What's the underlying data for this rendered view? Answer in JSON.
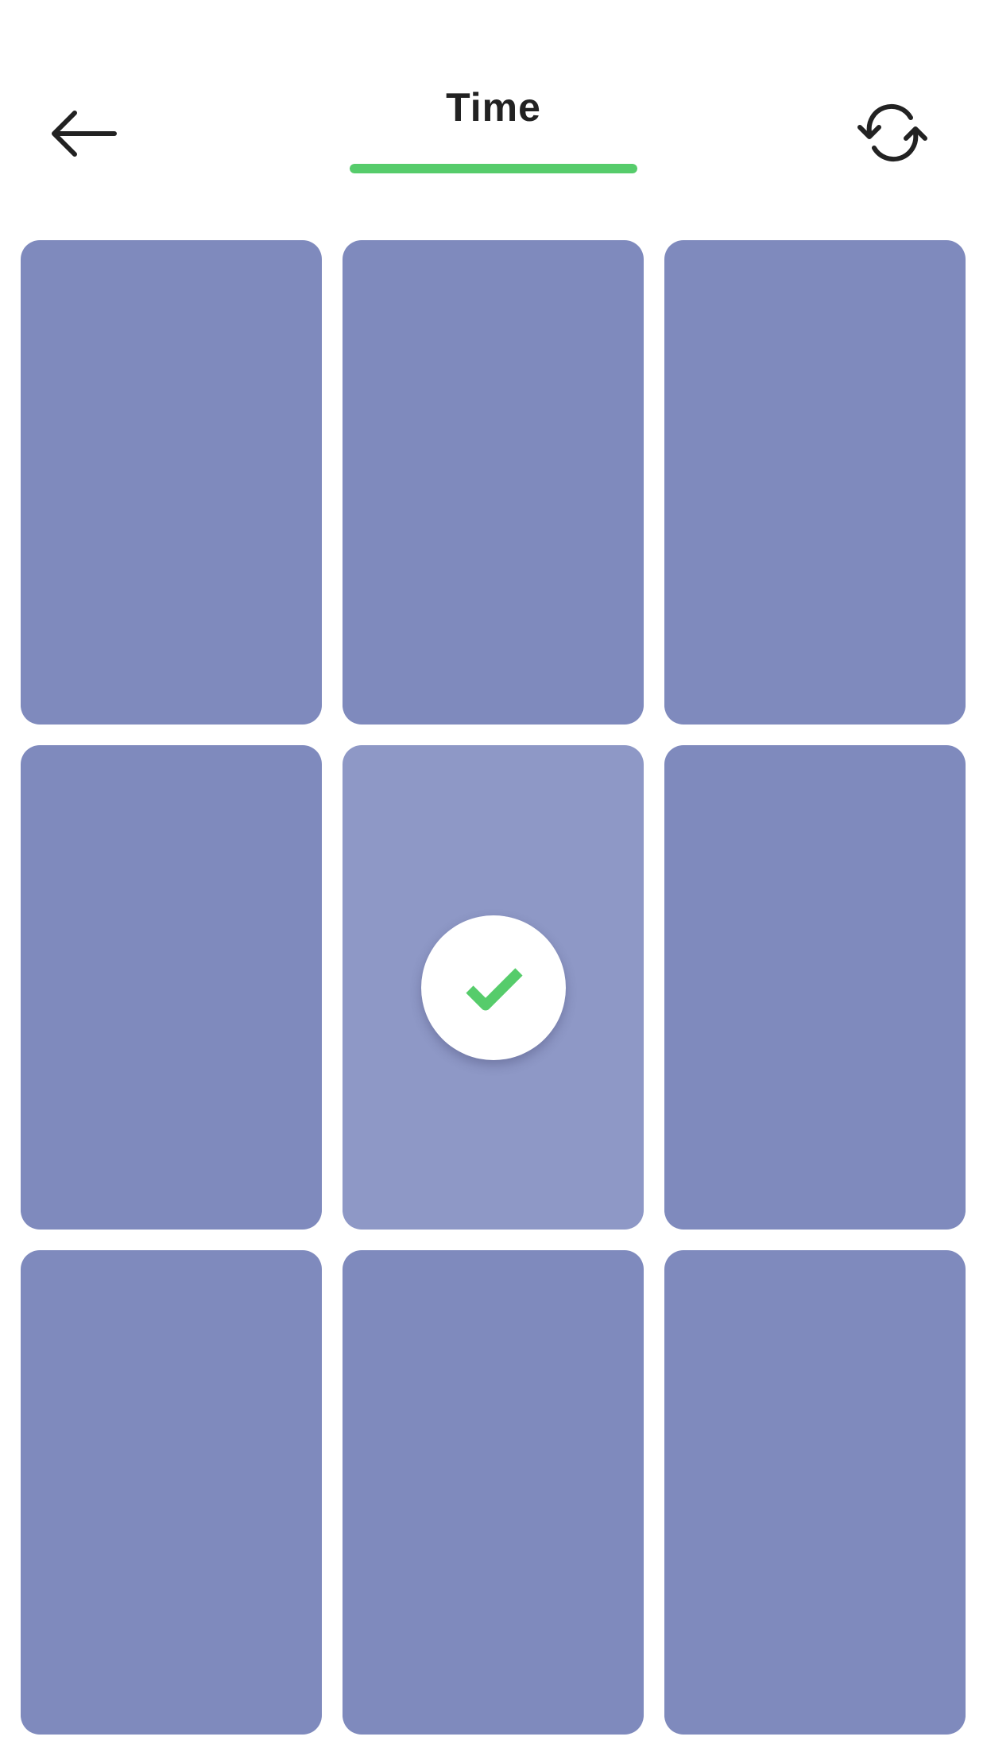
{
  "header": {
    "title": "Time",
    "back_icon": "arrow-left-icon",
    "refresh_icon": "refresh-icon"
  },
  "timer": {
    "fraction_remaining": 1.0
  },
  "board": {
    "rows": 3,
    "columns": 3,
    "cards": [
      {
        "state": "face-down"
      },
      {
        "state": "face-down"
      },
      {
        "state": "face-down"
      },
      {
        "state": "face-down"
      },
      {
        "state": "matched",
        "badge_icon": "check-icon"
      },
      {
        "state": "face-down"
      },
      {
        "state": "face-down"
      },
      {
        "state": "face-down"
      },
      {
        "state": "face-down"
      }
    ]
  },
  "colors": {
    "card": "#7f8abd",
    "card_matched": "#8e98c6",
    "accent_green": "#56cc6b",
    "icon_dark": "#222222"
  }
}
